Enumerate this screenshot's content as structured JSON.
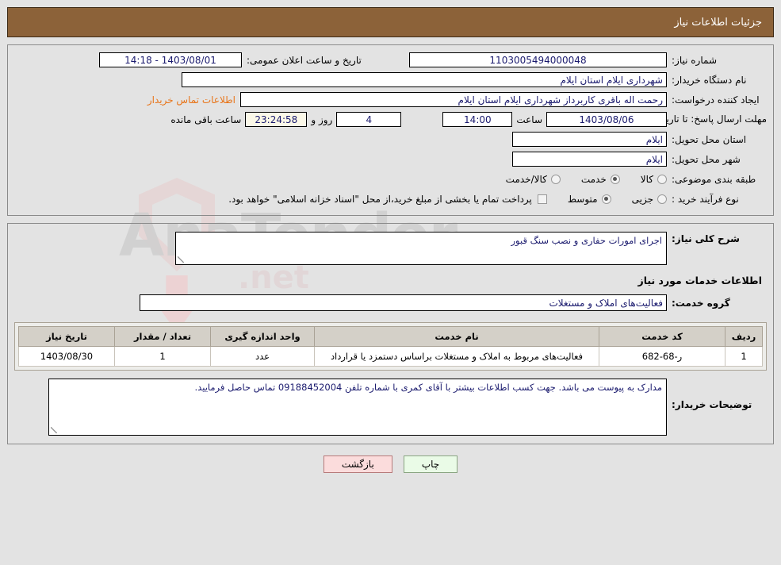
{
  "header": {
    "title": "جزئیات اطلاعات نیاز"
  },
  "summary": {
    "need_number_label": "شماره نیاز:",
    "need_number_value": "1103005494000048",
    "announce_datetime_label": "تاریخ و ساعت اعلان عمومی:",
    "announce_datetime_value": "14:18 - 1403/08/01",
    "buyer_org_label": "نام دستگاه خریدار:",
    "buyer_org_value": "شهرداری ایلام استان ایلام",
    "creator_label": "ایجاد کننده درخواست:",
    "creator_value": "رحمت اله باقری کاربرداز شهرداری ایلام استان ایلام",
    "contact_link": "اطلاعات تماس خریدار",
    "deadline_label": "مهلت ارسال پاسخ: تا تاریخ:",
    "deadline_date": "1403/08/06",
    "hour_label": "ساعت",
    "deadline_time": "14:00",
    "days_left": "4",
    "days_unit": "روز و",
    "time_left": "23:24:58",
    "time_left_unit": "ساعت باقی مانده",
    "province_label": "استان محل تحویل:",
    "province_value": "ایلام",
    "city_label": "شهر محل تحویل:",
    "city_value": "ایلام",
    "category_label": "طبقه بندی موضوعی:",
    "category_options": [
      {
        "label": "کالا",
        "selected": false
      },
      {
        "label": "خدمت",
        "selected": true
      },
      {
        "label": "کالا/خدمت",
        "selected": false
      }
    ],
    "process_label": "نوع فرآیند خرید :",
    "process_options": [
      {
        "label": "جزیی",
        "selected": false
      },
      {
        "label": "متوسط",
        "selected": true
      }
    ],
    "treasury_checkbox_checked": false,
    "treasury_note": "پرداخت تمام یا بخشی از مبلغ خرید،از محل \"اسناد خزانه اسلامی\" خواهد بود."
  },
  "details": {
    "general_desc_label": "شرح کلی نیاز:",
    "general_desc_value": "اجرای امورات حفاری و نصب سنگ قبور",
    "services_section_title": "اطلاعات خدمات مورد نیاز",
    "service_group_label": "گروه خدمت:",
    "service_group_value": "فعالیت‌های  املاک و مستغلات",
    "table": {
      "columns": [
        "ردیف",
        "کد خدمت",
        "نام خدمت",
        "واحد اندازه گیری",
        "تعداد / مقدار",
        "تاریخ نیاز"
      ],
      "rows": [
        {
          "row": "1",
          "code": "ر-68-682",
          "name": "فعالیت‌های مربوط به املاک و مستغلات براساس دستمزد یا قرارداد",
          "unit": "عدد",
          "qty": "1",
          "date": "1403/08/30"
        }
      ]
    },
    "buyer_notes_label": "توضیحات خریدار:",
    "buyer_notes_value": "مدارک به پیوست می باشد. جهت کسب اطلاعات بیشتر با آقای کمری با شماره تلفن 09188452004 تماس حاصل فرمایید."
  },
  "actions": {
    "print_label": "چاپ",
    "back_label": "بازگشت"
  },
  "watermark": {
    "text": "AnaTender",
    "text2": ".net"
  },
  "colors": {
    "header_bg": "#8c6239",
    "page_bg": "#e3e3e3",
    "link": "#e8751a",
    "field_text": "#1a1a6e",
    "print_btn": "#eafbe7",
    "back_btn": "#fbdcdc"
  }
}
